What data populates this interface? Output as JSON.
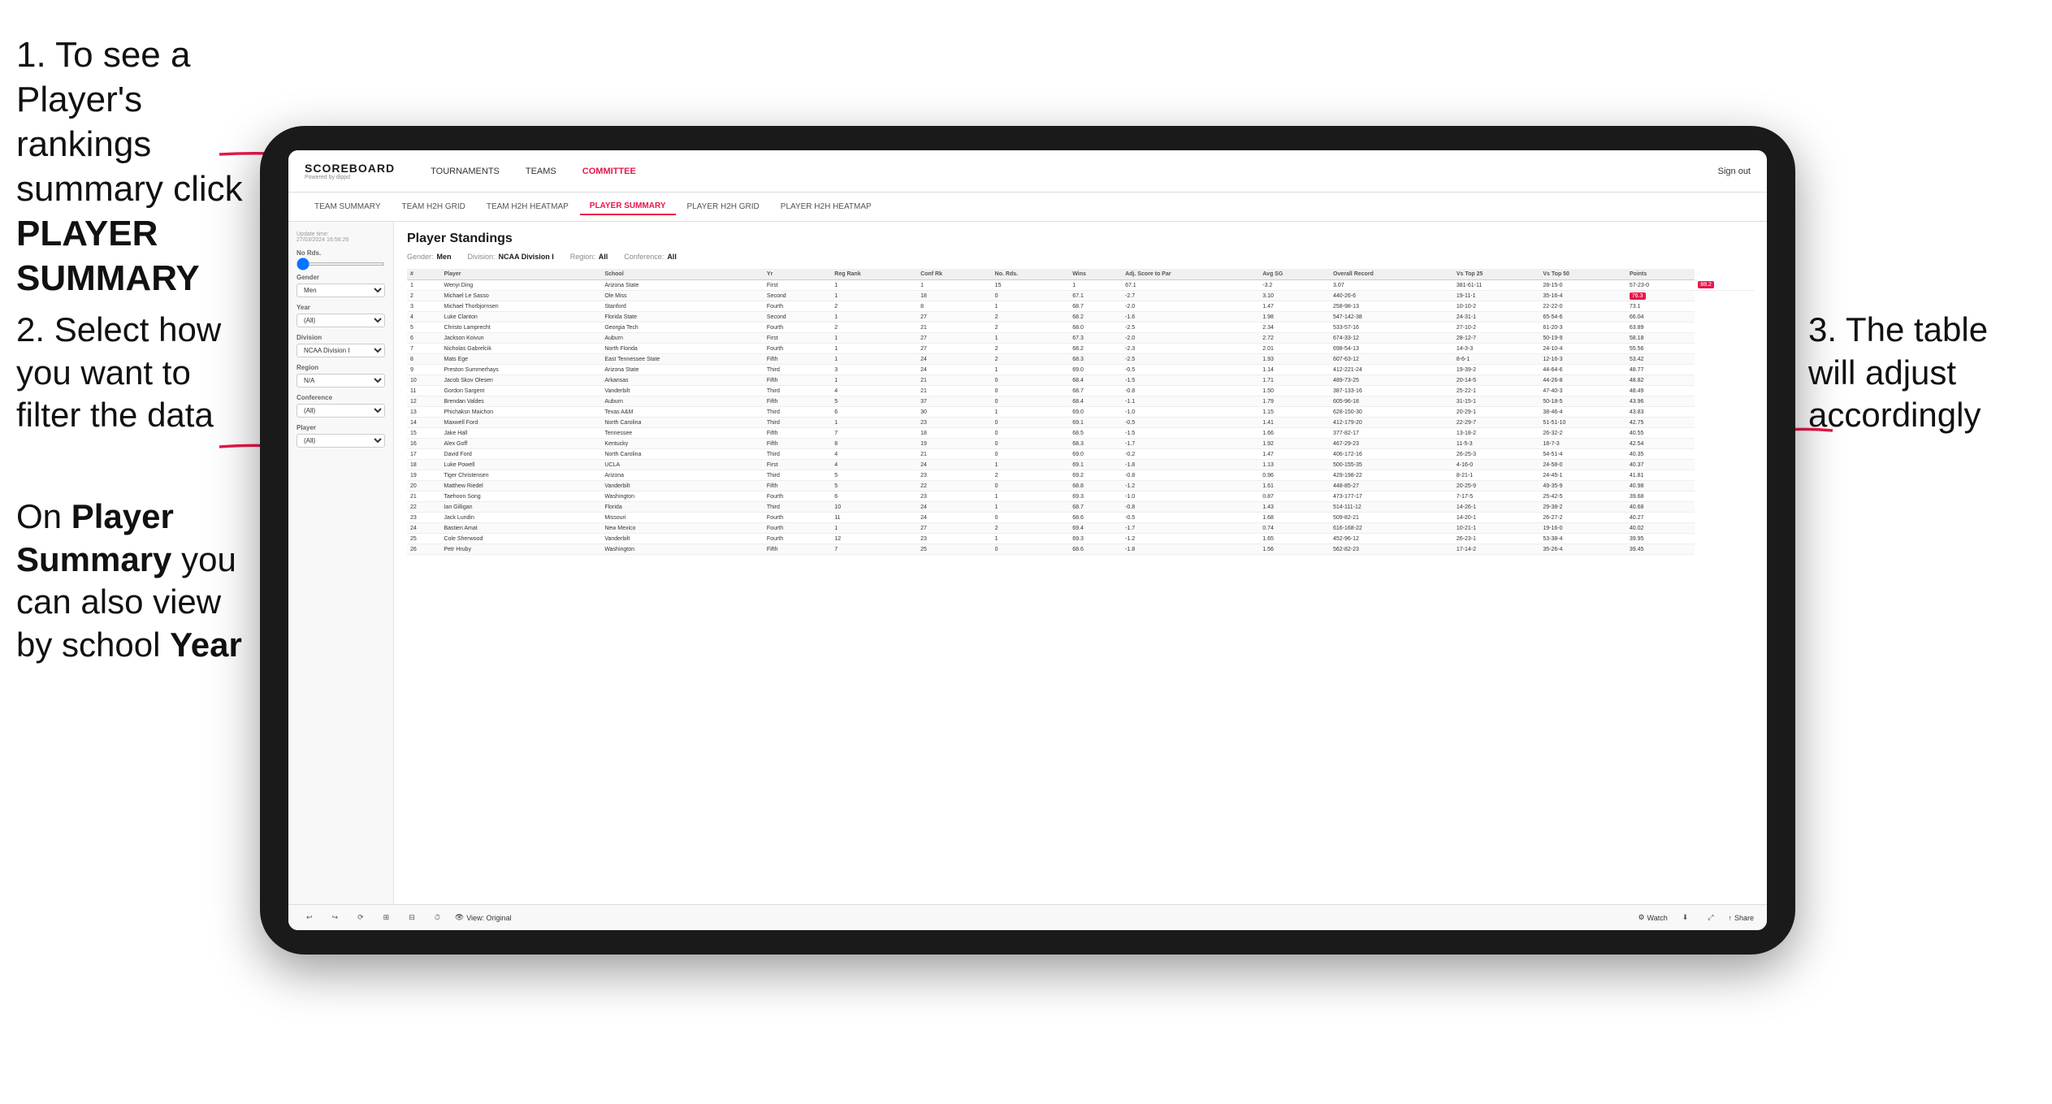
{
  "instructions": {
    "step1": "1. To see a Player's rankings summary click",
    "step1_bold": "PLAYER SUMMARY",
    "step2_title": "2. Select how you want to filter the data",
    "step2_note": "On ",
    "step2_bold1": "Player Summary",
    "step2_text": " you can also view by school ",
    "step2_bold2": "Year",
    "step3": "3. The table will adjust accordingly"
  },
  "app": {
    "logo": "SCOREBOARD",
    "logo_sub": "Powered by dippd",
    "nav": [
      "TOURNAMENTS",
      "TEAMS",
      "COMMITTEE"
    ],
    "sign_out": "Sign out",
    "sub_nav": [
      "TEAM SUMMARY",
      "TEAM H2H GRID",
      "TEAM H2H HEATMAP",
      "PLAYER SUMMARY",
      "PLAYER H2H GRID",
      "PLAYER H2H HEATMAP"
    ],
    "active_sub_nav": "PLAYER SUMMARY",
    "update_time": "Update time:\n27/03/2024 16:56:26",
    "section_title": "Player Standings",
    "filters": {
      "gender_label": "Gender:",
      "gender_value": "Men",
      "division_label": "Division:",
      "division_value": "NCAA Division I",
      "region_label": "Region:",
      "region_value": "All",
      "conference_label": "Conference:",
      "conference_value": "All"
    },
    "sidebar_filters": {
      "no_rds_label": "No Rds.",
      "gender_label": "Gender",
      "gender_value": "Men",
      "year_label": "Year",
      "year_value": "(All)",
      "division_label": "Division",
      "division_value": "NCAA Division I",
      "region_label": "Region",
      "region_value": "N/A",
      "conference_label": "Conference",
      "conference_value": "(All)",
      "player_label": "Player",
      "player_value": "(All)"
    },
    "table_headers": [
      "#",
      "Player",
      "School",
      "Yr",
      "Reg Rank",
      "Conf Rk",
      "No. Rds.",
      "Wins",
      "Adj. Score to Par",
      "Avg SG",
      "Overall Record",
      "Vs Top 25",
      "Vs Top 50",
      "Points"
    ],
    "table_rows": [
      [
        "1",
        "Wenyi Ding",
        "Arizona State",
        "First",
        "1",
        "1",
        "15",
        "1",
        "67.1",
        "-3.2",
        "3.07",
        "381-61-11",
        "28-15-0",
        "57-23-0",
        "88.2"
      ],
      [
        "2",
        "Michael Le Sasso",
        "Ole Miss",
        "Second",
        "1",
        "18",
        "0",
        "67.1",
        "-2.7",
        "3.10",
        "440-26-6",
        "19-11-1",
        "35-16-4",
        "76.3"
      ],
      [
        "3",
        "Michael Thorbjornsen",
        "Stanford",
        "Fourth",
        "2",
        "8",
        "1",
        "68.7",
        "-2.0",
        "1.47",
        "258-98-13",
        "10-10-2",
        "22-22-0",
        "73.1"
      ],
      [
        "4",
        "Luke Clanton",
        "Florida State",
        "Second",
        "1",
        "27",
        "2",
        "68.2",
        "-1.6",
        "1.98",
        "547-142-38",
        "24-31-1",
        "65-54-6",
        "66.04"
      ],
      [
        "5",
        "Christo Lamprecht",
        "Georgia Tech",
        "Fourth",
        "2",
        "21",
        "2",
        "68.0",
        "-2.5",
        "2.34",
        "533-57-16",
        "27-10-2",
        "61-20-3",
        "63.89"
      ],
      [
        "6",
        "Jackson Koivun",
        "Auburn",
        "First",
        "1",
        "27",
        "1",
        "67.3",
        "-2.0",
        "2.72",
        "674-33-12",
        "28-12-7",
        "50-19-9",
        "58.18"
      ],
      [
        "7",
        "Nicholas Gabrelcik",
        "North Florida",
        "Fourth",
        "1",
        "27",
        "2",
        "68.2",
        "-2.3",
        "2.01",
        "698-54-13",
        "14-3-3",
        "24-10-4",
        "55.56"
      ],
      [
        "8",
        "Mats Ege",
        "East Tennessee State",
        "Fifth",
        "1",
        "24",
        "2",
        "68.3",
        "-2.5",
        "1.93",
        "607-63-12",
        "8-6-1",
        "12-16-3",
        "53.42"
      ],
      [
        "9",
        "Preston Summerhays",
        "Arizona State",
        "Third",
        "3",
        "24",
        "1",
        "69.0",
        "-0.5",
        "1.14",
        "412-221-24",
        "19-39-2",
        "44-64-6",
        "48.77"
      ],
      [
        "10",
        "Jacob Skov Olesen",
        "Arkansas",
        "Fifth",
        "1",
        "21",
        "0",
        "68.4",
        "-1.5",
        "1.71",
        "489-73-25",
        "20-14-5",
        "44-26-8",
        "48.82"
      ],
      [
        "11",
        "Gordon Sargent",
        "Vanderbilt",
        "Third",
        "4",
        "21",
        "0",
        "68.7",
        "-0.8",
        "1.50",
        "387-133-16",
        "25-22-1",
        "47-40-3",
        "48.49"
      ],
      [
        "12",
        "Brendan Valdes",
        "Auburn",
        "Fifth",
        "5",
        "37",
        "0",
        "68.4",
        "-1.1",
        "1.79",
        "605-96-18",
        "31-15-1",
        "50-18-5",
        "43.96"
      ],
      [
        "13",
        "Phichaksn Maichon",
        "Texas A&M",
        "Third",
        "6",
        "30",
        "1",
        "69.0",
        "-1.0",
        "1.15",
        "628-150-30",
        "20-29-1",
        "38-46-4",
        "43.83"
      ],
      [
        "14",
        "Maxwell Ford",
        "North Carolina",
        "Third",
        "1",
        "23",
        "0",
        "69.1",
        "-0.5",
        "1.41",
        "412-179-20",
        "22-29-7",
        "51-51-10",
        "42.75"
      ],
      [
        "15",
        "Jake Hall",
        "Tennessee",
        "Fifth",
        "7",
        "18",
        "0",
        "68.5",
        "-1.5",
        "1.66",
        "377-82-17",
        "13-18-2",
        "26-32-2",
        "40.55"
      ],
      [
        "16",
        "Alex Goff",
        "Kentucky",
        "Fifth",
        "8",
        "19",
        "0",
        "68.3",
        "-1.7",
        "1.92",
        "467-29-23",
        "11-5-3",
        "18-7-3",
        "42.54"
      ],
      [
        "17",
        "David Ford",
        "North Carolina",
        "Third",
        "4",
        "21",
        "0",
        "69.0",
        "-0.2",
        "1.47",
        "406-172-16",
        "26-25-3",
        "54-51-4",
        "40.35"
      ],
      [
        "18",
        "Luke Powell",
        "UCLA",
        "First",
        "4",
        "24",
        "1",
        "69.1",
        "-1.8",
        "1.13",
        "500-155-35",
        "4-16-0",
        "24-58-0",
        "40.37"
      ],
      [
        "19",
        "Tiger Christensen",
        "Arizona",
        "Third",
        "5",
        "23",
        "2",
        "69.2",
        "-0.8",
        "0.96",
        "429-198-22",
        "8-21-1",
        "24-45-1",
        "41.81"
      ],
      [
        "20",
        "Matthew Riedel",
        "Vanderbilt",
        "Fifth",
        "5",
        "22",
        "0",
        "68.8",
        "-1.2",
        "1.61",
        "448-85-27",
        "20-25-9",
        "49-35-9",
        "40.98"
      ],
      [
        "21",
        "Taehoon Song",
        "Washington",
        "Fourth",
        "6",
        "23",
        "1",
        "69.3",
        "-1.0",
        "0.87",
        "473-177-17",
        "7-17-5",
        "25-42-5",
        "39.68"
      ],
      [
        "22",
        "Ian Gilligan",
        "Florida",
        "Third",
        "10",
        "24",
        "1",
        "68.7",
        "-0.8",
        "1.43",
        "514-111-12",
        "14-26-1",
        "29-38-2",
        "40.68"
      ],
      [
        "23",
        "Jack Lundin",
        "Missouri",
        "Fourth",
        "11",
        "24",
        "0",
        "68.6",
        "-0.5",
        "1.68",
        "509-82-21",
        "14-20-1",
        "26-27-2",
        "40.27"
      ],
      [
        "24",
        "Bastien Amat",
        "New Mexico",
        "Fourth",
        "1",
        "27",
        "2",
        "69.4",
        "-1.7",
        "0.74",
        "616-168-22",
        "10-21-1",
        "19-16-0",
        "40.02"
      ],
      [
        "25",
        "Cole Sherwood",
        "Vanderbilt",
        "Fourth",
        "12",
        "23",
        "1",
        "69.3",
        "-1.2",
        "1.65",
        "452-96-12",
        "26-23-1",
        "53-38-4",
        "39.95"
      ],
      [
        "26",
        "Petr Hruby",
        "Washington",
        "Fifth",
        "7",
        "25",
        "0",
        "68.6",
        "-1.8",
        "1.56",
        "562-82-23",
        "17-14-2",
        "35-26-4",
        "39.45"
      ]
    ],
    "bottom_toolbar": {
      "view_label": "View: Original",
      "watch_label": "Watch",
      "share_label": "Share"
    }
  }
}
